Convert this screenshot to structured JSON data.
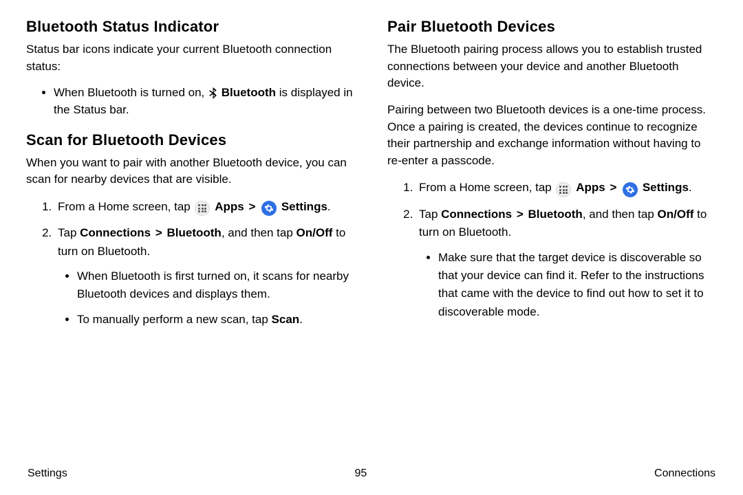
{
  "left": {
    "section1": {
      "heading": "Bluetooth Status Indicator",
      "intro": "Status bar icons indicate your current Bluetooth connection status:",
      "bullet_pre": "When Bluetooth is turned on, ",
      "bullet_bold": "Bluetooth",
      "bullet_post": " is displayed in the Status bar."
    },
    "section2": {
      "heading": "Scan for Bluetooth Devices",
      "intro": "When you want to pair with another Bluetooth device, you can scan for nearby devices that are visible.",
      "step1_pre": "From a Home screen, tap ",
      "apps": "Apps",
      "chev": ">",
      "settings": "Settings",
      "step1_post": ".",
      "step2_pre": "Tap ",
      "step2_bold1": "Connections",
      "step2_mid1": " ",
      "step2_bold2": "Bluetooth",
      "step2_mid2": ", and then tap ",
      "step2_bold3": "On/Off",
      "step2_post": " to turn on Bluetooth.",
      "sub1": "When Bluetooth is first turned on, it scans for nearby Bluetooth devices and displays them.",
      "sub2_pre": "To manually perform a new scan, tap ",
      "sub2_bold": "Scan",
      "sub2_post": "."
    }
  },
  "right": {
    "section1": {
      "heading": "Pair Bluetooth Devices",
      "p1": "The Bluetooth pairing process allows you to establish trusted connections between your device and another Bluetooth device.",
      "p2": "Pairing between two Bluetooth devices is a one-time process. Once a pairing is created, the devices continue to recognize their partnership and exchange information without having to re-enter a passcode.",
      "step1_pre": "From a Home screen, tap ",
      "apps": "Apps",
      "chev": ">",
      "settings": "Settings",
      "step1_post": ".",
      "step2_pre": "Tap ",
      "step2_bold1": "Connections",
      "step2_bold2": "Bluetooth",
      "step2_mid2": ", and then tap ",
      "step2_bold3": "On/Off",
      "step2_post": " to turn on Bluetooth.",
      "sub1": "Make sure that the target device is discoverable so that your device can find it. Refer to the instructions that came with the device to find out how to set it to discoverable mode."
    }
  },
  "footer": {
    "left": "Settings",
    "center": "95",
    "right": "Connections"
  }
}
